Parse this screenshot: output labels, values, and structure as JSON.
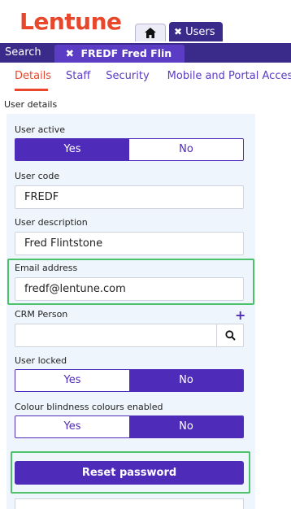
{
  "logo": "Lentune",
  "top_tabs": {
    "users_label": "Users",
    "close_glyph": "✖"
  },
  "sub_tabs": {
    "search_label": "Search",
    "record_label": "FREDF Fred Flin",
    "close_glyph": "✖"
  },
  "nav": {
    "details": "Details",
    "staff": "Staff",
    "security": "Security",
    "mobile": "Mobile and Portal Access"
  },
  "section_title": "User details",
  "form": {
    "user_active": {
      "label": "User active",
      "yes": "Yes",
      "no": "No",
      "value": "Yes"
    },
    "user_code": {
      "label": "User code",
      "value": "FREDF"
    },
    "user_description": {
      "label": "User description",
      "value": "Fred Flintstone"
    },
    "email": {
      "label": "Email address",
      "value": "fredf@lentune.com"
    },
    "crm_person": {
      "label": "CRM Person",
      "add_glyph": "+",
      "value": ""
    },
    "user_locked": {
      "label": "User locked",
      "yes": "Yes",
      "no": "No",
      "value": "No"
    },
    "colour_blindness": {
      "label": "Colour blindness colours enabled",
      "yes": "Yes",
      "no": "No",
      "value": "No"
    },
    "reset_password": "Reset password"
  },
  "colors": {
    "brand": "#e8472b",
    "primary": "#4e2bb8",
    "header": "#3a2a8a",
    "highlight": "#4cc36a",
    "panel": "#eef5fc"
  },
  "icons": {
    "home": "home-icon",
    "search": "search-icon"
  }
}
